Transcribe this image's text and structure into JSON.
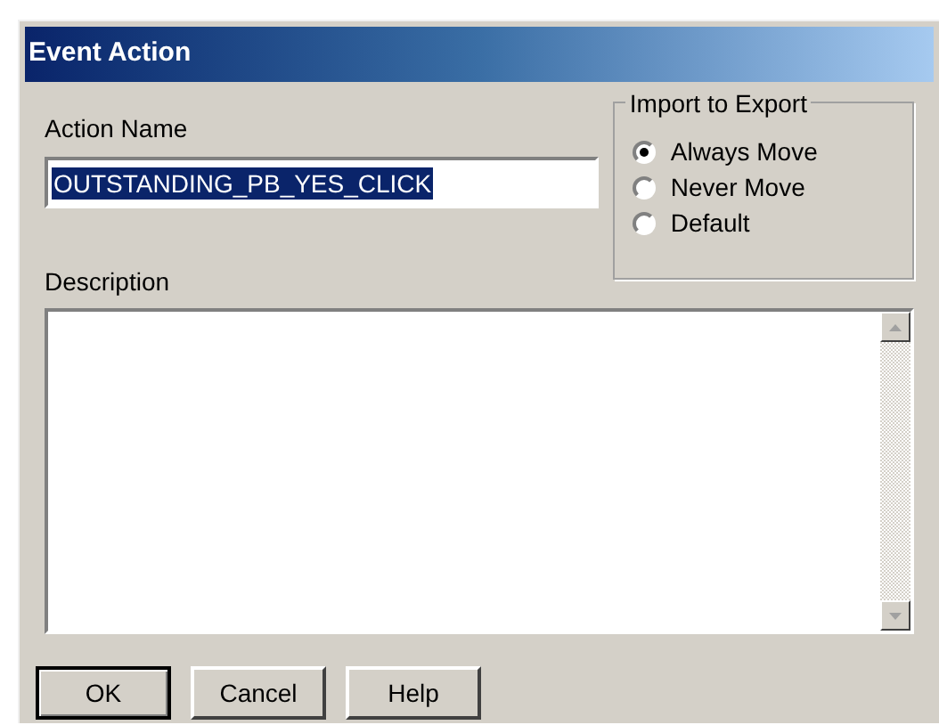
{
  "window": {
    "title": "Event Action"
  },
  "action_name": {
    "label": "Action Name",
    "value": "OUTSTANDING_PB_YES_CLICK",
    "selected_text": true
  },
  "import_to_export": {
    "label": "Import to Export",
    "options": [
      {
        "label": "Always Move",
        "selected": true
      },
      {
        "label": "Never Move",
        "selected": false
      },
      {
        "label": "Default",
        "selected": false
      }
    ]
  },
  "description": {
    "label": "Description"
  },
  "buttons": [
    {
      "label": "OK",
      "default": true
    },
    {
      "label": "Cancel",
      "default": false
    },
    {
      "label": "Help",
      "default": false
    }
  ]
}
